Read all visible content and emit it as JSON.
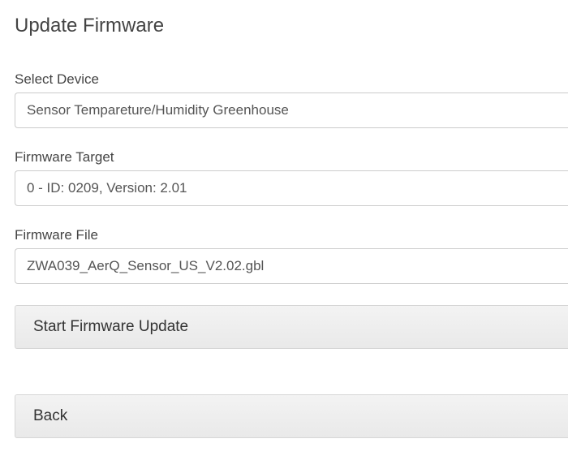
{
  "header": {
    "title": "Update Firmware"
  },
  "form": {
    "device": {
      "label": "Select Device",
      "value": "Sensor Tempareture/Humidity Greenhouse"
    },
    "target": {
      "label": "Firmware Target",
      "value": "0 - ID: 0209, Version: 2.01"
    },
    "file": {
      "label": "Firmware File",
      "value": "ZWA039_AerQ_Sensor_US_V2.02.gbl"
    }
  },
  "buttons": {
    "start": "Start Firmware Update",
    "back": "Back"
  }
}
